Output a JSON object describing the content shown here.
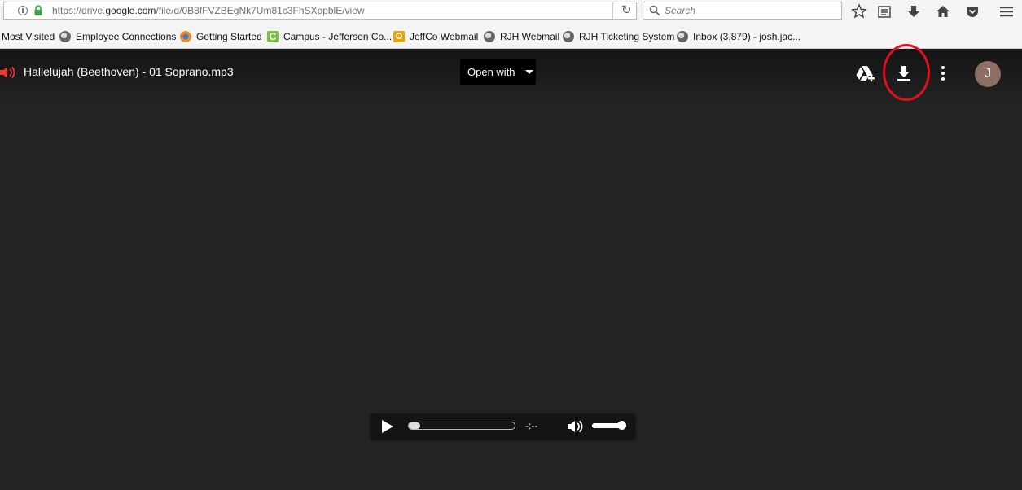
{
  "browser": {
    "url_prefix": "https://drive.",
    "url_domain": "google.com",
    "url_path": "/file/d/0B8fFVZBEgNk7Um81c3FhSXppblE/view",
    "search_placeholder": "Search",
    "toolbar_icons": [
      "star-icon",
      "reader-icon",
      "downloads-icon",
      "home-icon",
      "pocket-icon",
      "menu-icon"
    ]
  },
  "bookmarks": [
    {
      "label": "Most Visited",
      "icon": "none"
    },
    {
      "label": "Employee Connections",
      "icon": "globe-icon"
    },
    {
      "label": "Getting Started",
      "icon": "firefox-icon"
    },
    {
      "label": "Campus - Jefferson Co...",
      "icon": "campus-icon"
    },
    {
      "label": "JeffCo Webmail",
      "icon": "outlook-icon"
    },
    {
      "label": "RJH Webmail",
      "icon": "globe-icon"
    },
    {
      "label": "RJH Ticketing System",
      "icon": "globe-icon"
    },
    {
      "label": "Inbox (3,879) - josh.jac...",
      "icon": "globe-icon"
    }
  ],
  "viewer": {
    "file_title": "Hallelujah (Beethoven) - 01 Soprano.mp3",
    "open_with_label": "Open with",
    "avatar_initial": "J",
    "annotation_color": "#e01020",
    "audio": {
      "time_label": "-:--",
      "progress": 0.0,
      "volume": 1.0
    }
  }
}
